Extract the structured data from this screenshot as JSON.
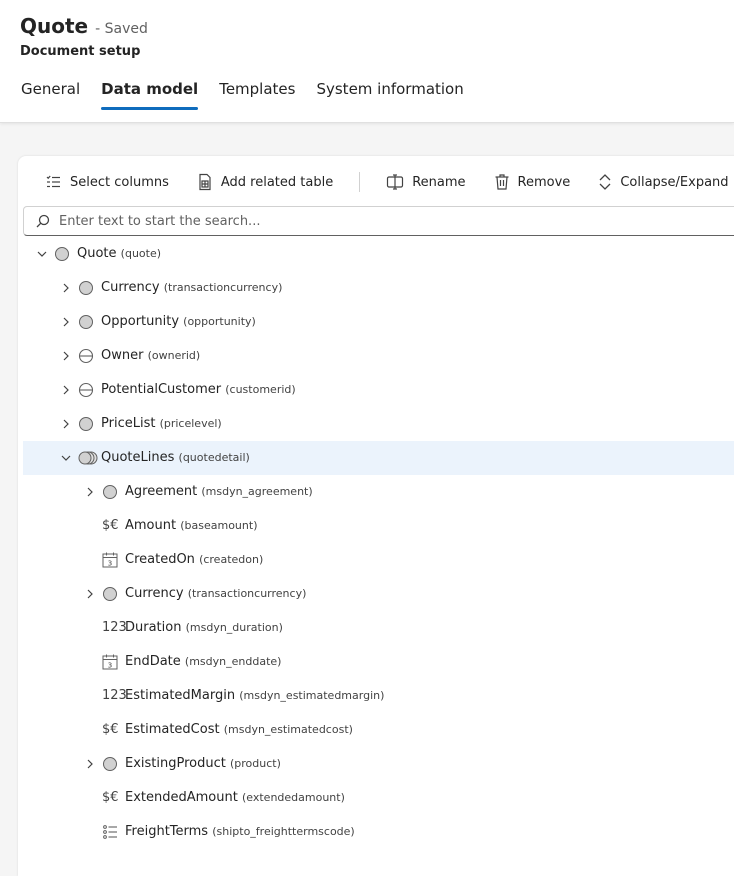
{
  "header": {
    "title": "Quote",
    "saved": "- Saved",
    "subtitle": "Document setup",
    "tabs": [
      {
        "label": "General",
        "active": false
      },
      {
        "label": "Data model",
        "active": true
      },
      {
        "label": "Templates",
        "active": false
      },
      {
        "label": "System information",
        "active": false
      }
    ]
  },
  "toolbar": {
    "select_columns": "Select columns",
    "add_related_table": "Add related table",
    "rename": "Rename",
    "remove": "Remove",
    "collapse_expand": "Collapse/Expand"
  },
  "search": {
    "placeholder": "Enter text to start the search..."
  },
  "colors": {
    "accent": "#0f6cbd",
    "selected_row": "#ebf3fc"
  },
  "tree": [
    {
      "name": "Quote",
      "logical": "(quote)",
      "level": 0,
      "chevron": "down",
      "icon": "circle-icon",
      "selected": false
    },
    {
      "name": "Currency",
      "logical": "(transactioncurrency)",
      "level": 1,
      "chevron": "right",
      "icon": "circle-icon",
      "selected": false
    },
    {
      "name": "Opportunity",
      "logical": "(opportunity)",
      "level": 1,
      "chevron": "right",
      "icon": "circle-icon",
      "selected": false
    },
    {
      "name": "Owner",
      "logical": "(ownerid)",
      "level": 1,
      "chevron": "right",
      "icon": "split-circle-icon",
      "selected": false
    },
    {
      "name": "PotentialCustomer",
      "logical": "(customerid)",
      "level": 1,
      "chevron": "right",
      "icon": "split-circle-icon",
      "selected": false
    },
    {
      "name": "PriceList",
      "logical": "(pricelevel)",
      "level": 1,
      "chevron": "right",
      "icon": "circle-icon",
      "selected": false
    },
    {
      "name": "QuoteLines",
      "logical": "(quotedetail)",
      "level": 1,
      "chevron": "down",
      "icon": "stacked-circles-icon",
      "selected": true
    },
    {
      "name": "Agreement",
      "logical": "(msdyn_agreement)",
      "level": 2,
      "chevron": "right",
      "icon": "circle-icon",
      "selected": false
    },
    {
      "name": "Amount",
      "logical": "(baseamount)",
      "level": 2,
      "chevron": "none",
      "icon": "currency-icon",
      "icon_text": "$€",
      "selected": false
    },
    {
      "name": "CreatedOn",
      "logical": "(createdon)",
      "level": 2,
      "chevron": "none",
      "icon": "calendar-icon",
      "selected": false
    },
    {
      "name": "Currency",
      "logical": "(transactioncurrency)",
      "level": 2,
      "chevron": "right",
      "icon": "circle-icon",
      "selected": false
    },
    {
      "name": "Duration",
      "logical": "(msdyn_duration)",
      "level": 2,
      "chevron": "none",
      "icon": "number-icon",
      "icon_text": "123",
      "selected": false
    },
    {
      "name": "EndDate",
      "logical": "(msdyn_enddate)",
      "level": 2,
      "chevron": "none",
      "icon": "calendar-icon",
      "selected": false
    },
    {
      "name": "EstimatedMargin",
      "logical": "(msdyn_estimatedmargin)",
      "level": 2,
      "chevron": "none",
      "icon": "number-icon",
      "icon_text": "123",
      "selected": false
    },
    {
      "name": "EstimatedCost",
      "logical": "(msdyn_estimatedcost)",
      "level": 2,
      "chevron": "none",
      "icon": "currency-icon",
      "icon_text": "$€",
      "selected": false
    },
    {
      "name": "ExistingProduct",
      "logical": "(product)",
      "level": 2,
      "chevron": "right",
      "icon": "circle-icon",
      "selected": false
    },
    {
      "name": "ExtendedAmount",
      "logical": "(extendedamount)",
      "level": 2,
      "chevron": "none",
      "icon": "currency-icon",
      "icon_text": "$€",
      "selected": false
    },
    {
      "name": "FreightTerms",
      "logical": "(shipto_freighttermscode)",
      "level": 2,
      "chevron": "none",
      "icon": "option-set-icon",
      "selected": false
    }
  ]
}
